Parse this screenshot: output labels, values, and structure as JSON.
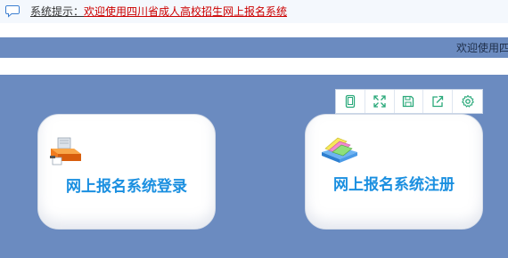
{
  "notice": {
    "icon": "speech-bubble-icon",
    "prefix": "系统提示：",
    "message": "欢迎使用四川省成人高校招生网上报名系统"
  },
  "welcome": {
    "text": "欢迎使用四"
  },
  "toolbar": {
    "buttons": [
      {
        "icon": "tablet-icon"
      },
      {
        "icon": "fullscreen-icon"
      },
      {
        "icon": "save-icon"
      },
      {
        "icon": "share-icon"
      },
      {
        "icon": "gear-icon"
      }
    ]
  },
  "cards": {
    "login": {
      "label": "网上报名系统登录",
      "icon": "printer-icon"
    },
    "register": {
      "label": "网上报名系统注册",
      "icon": "books-icon"
    }
  },
  "colors": {
    "band": "#6b8bc0",
    "notice_message": "#cc0000",
    "card_title": "#1a8fe0",
    "toolbar_icon": "#2aa97a"
  }
}
